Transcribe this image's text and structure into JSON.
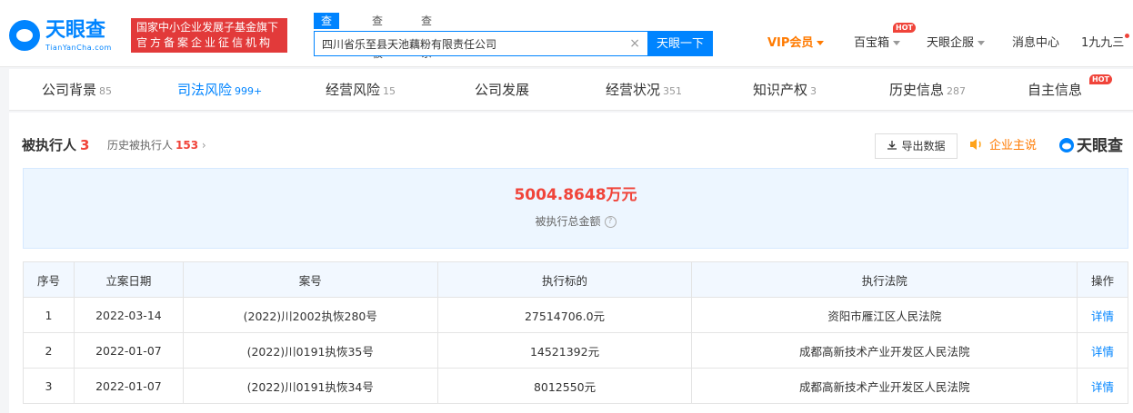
{
  "header": {
    "logo_text": "天眼查",
    "logo_sub": "TianYanCha.com",
    "banner_line1": "国家中小企业发展子基金旗下",
    "banner_line2": "官方备案企业征信机构",
    "search_tabs": [
      "查公司",
      "查老板",
      "查关系"
    ],
    "search_value": "四川省乐至县天池藕粉有限责任公司",
    "search_clear": "×",
    "search_button": "天眼一下",
    "nav": {
      "vip": "VIP会员",
      "treasure": "百宝箱",
      "enterprise": "天眼企服",
      "messages": "消息中心",
      "user": "1九九三"
    },
    "hot_badge": "HOT"
  },
  "tabs": [
    {
      "label": "公司背景",
      "count": "85"
    },
    {
      "label": "司法风险",
      "count": "999+"
    },
    {
      "label": "经营风险",
      "count": "15"
    },
    {
      "label": "公司发展",
      "count": ""
    },
    {
      "label": "经营状况",
      "count": "351"
    },
    {
      "label": "知识产权",
      "count": "3"
    },
    {
      "label": "历史信息",
      "count": "287"
    },
    {
      "label": "自主信息",
      "count": ""
    }
  ],
  "section": {
    "title": "被执行人",
    "count": "3",
    "history_label": "历史被执行人",
    "history_count": "153",
    "history_arrow": "›",
    "export_label": "导出数据",
    "zhushuo_label": "企业主说",
    "brand": "天眼查"
  },
  "summary": {
    "value": "5004.8648万元",
    "label": "被执行总金额",
    "help": "?"
  },
  "table": {
    "headers": [
      "序号",
      "立案日期",
      "案号",
      "执行标的",
      "执行法院",
      "操作"
    ],
    "rows": [
      [
        "1",
        "2022-03-14",
        "(2022)川2002执恢280号",
        "27514706.0元",
        "资阳市雁江区人民法院",
        "详情"
      ],
      [
        "2",
        "2022-01-07",
        "(2022)川0191执恢35号",
        "14521392元",
        "成都高新技术产业开发区人民法院",
        "详情"
      ],
      [
        "3",
        "2022-01-07",
        "(2022)川0191执恢34号",
        "8012550元",
        "成都高新技术产业开发区人民法院",
        "详情"
      ]
    ]
  }
}
